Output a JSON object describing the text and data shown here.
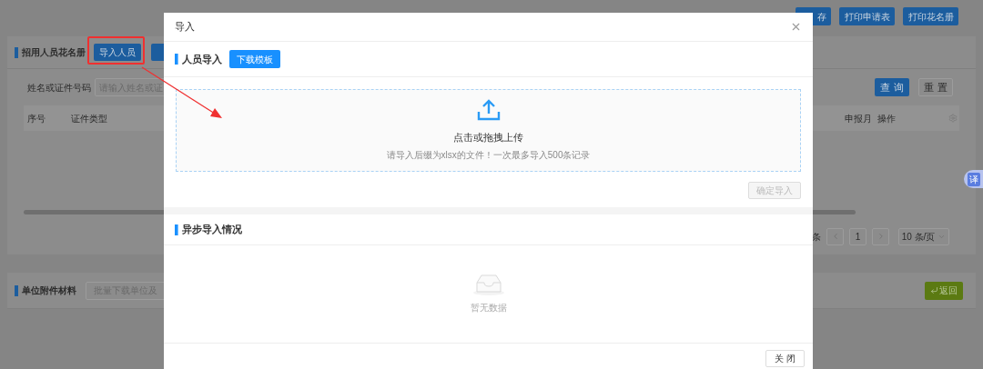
{
  "page": {
    "top_buttons": [
      "存",
      "打印申请表",
      "打印花名册"
    ],
    "roster": {
      "title": "招用人员花名册",
      "import_button": "导入人员"
    },
    "search": {
      "label": "姓名或证件号码",
      "placeholder": "请输入姓名或证",
      "query_button": "查 询",
      "reset_button": "重 置"
    },
    "table": {
      "columns_left": [
        "序号",
        "证件类型"
      ],
      "columns_right": [
        "申报月",
        "操作"
      ]
    },
    "pagination": {
      "total_suffix": "条",
      "page": "1",
      "page_size": "10 条/页"
    },
    "attachments": {
      "title": "单位附件材料",
      "placeholder": "批量下载单位及"
    },
    "back_button": "返回",
    "translate_badge": "译"
  },
  "dialog": {
    "title": "导入",
    "import_section": {
      "title": "人员导入",
      "template_button": "下载模板",
      "upload_title": "点击或拖拽上传",
      "upload_hint": "请导入后缀为xlsx的文件！一次最多导入500条记录",
      "confirm_button": {
        "label": "确定导入",
        "disabled": true
      }
    },
    "async_section": {
      "title": "异步导入情况",
      "empty_text": "暂无数据"
    },
    "close_button": "关 闭"
  }
}
